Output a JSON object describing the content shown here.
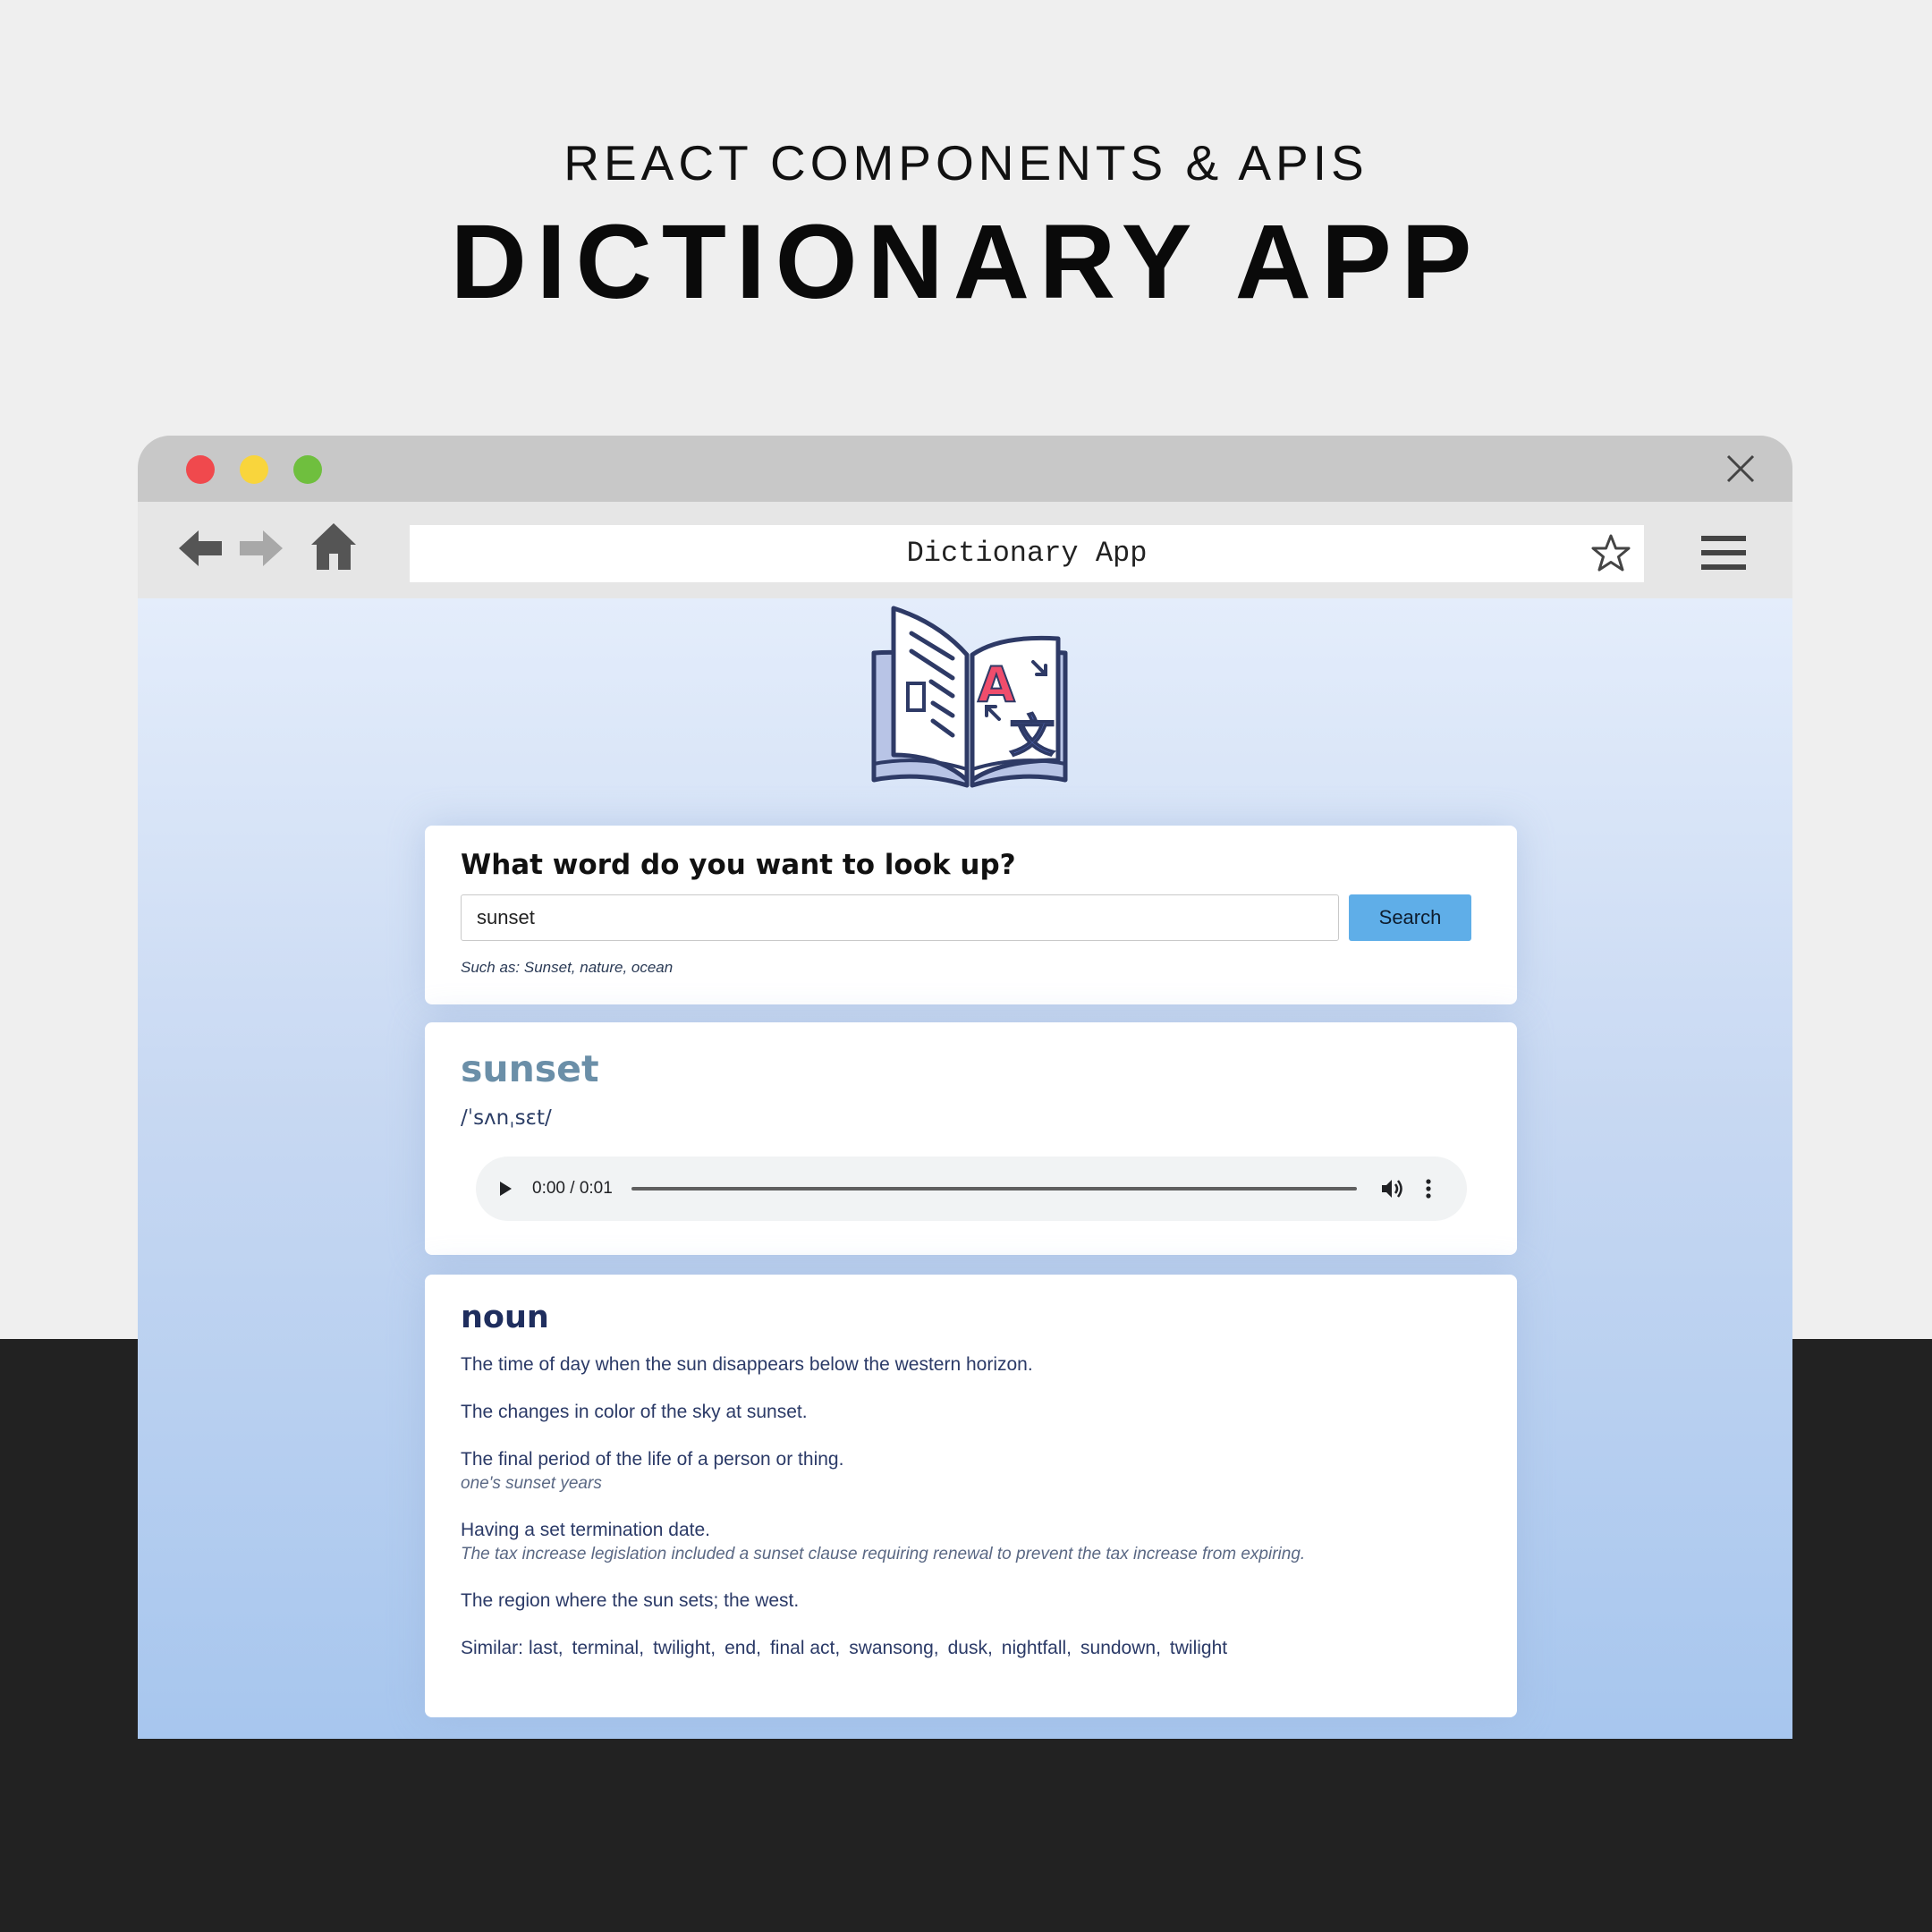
{
  "hero": {
    "subtitle": "REACT COMPONENTS & APIS",
    "title": "DICTIONARY APP"
  },
  "browser": {
    "address_text": "Dictionary App",
    "traffic_lights": [
      "#f0494d",
      "#f9d53c",
      "#6fbf3e"
    ]
  },
  "search": {
    "heading": "What word do you want to look up?",
    "input_value": "sunset",
    "button_label": "Search",
    "hint": "Such as: Sunset, nature, ocean"
  },
  "result": {
    "word": "sunset",
    "phonetic": "/ˈsʌnˌsɛt/",
    "audio": {
      "time": "0:00 / 0:01"
    }
  },
  "meaning": {
    "part_of_speech": "noun",
    "definitions": [
      {
        "text": "The time of day when the sun disappears below the western horizon.",
        "example": ""
      },
      {
        "text": "The changes in color of the sky at sunset.",
        "example": ""
      },
      {
        "text": "The final period of the life of a person or thing.",
        "example": "one's sunset years"
      },
      {
        "text": "Having a set termination date.",
        "example": "The tax increase legislation included a sunset clause requiring renewal to prevent the tax increase from expiring."
      },
      {
        "text": "The region where the sun sets; the west.",
        "example": ""
      }
    ],
    "similar_label": "Similar:",
    "similar": [
      "last,",
      "terminal,",
      "twilight,",
      "end,",
      "final act,",
      "swansong,",
      "dusk,",
      "nightfall,",
      "sundown,",
      "twilight"
    ]
  },
  "colors": {
    "accent_button": "#5faee8",
    "word_color": "#6b8fa8",
    "text_navy": "#2b3a67"
  },
  "icons": [
    "close-icon",
    "back-arrow-icon",
    "forward-arrow-icon",
    "home-icon",
    "star-icon",
    "hamburger-menu-icon",
    "dictionary-book-logo",
    "play-icon",
    "volume-icon",
    "more-options-icon"
  ]
}
